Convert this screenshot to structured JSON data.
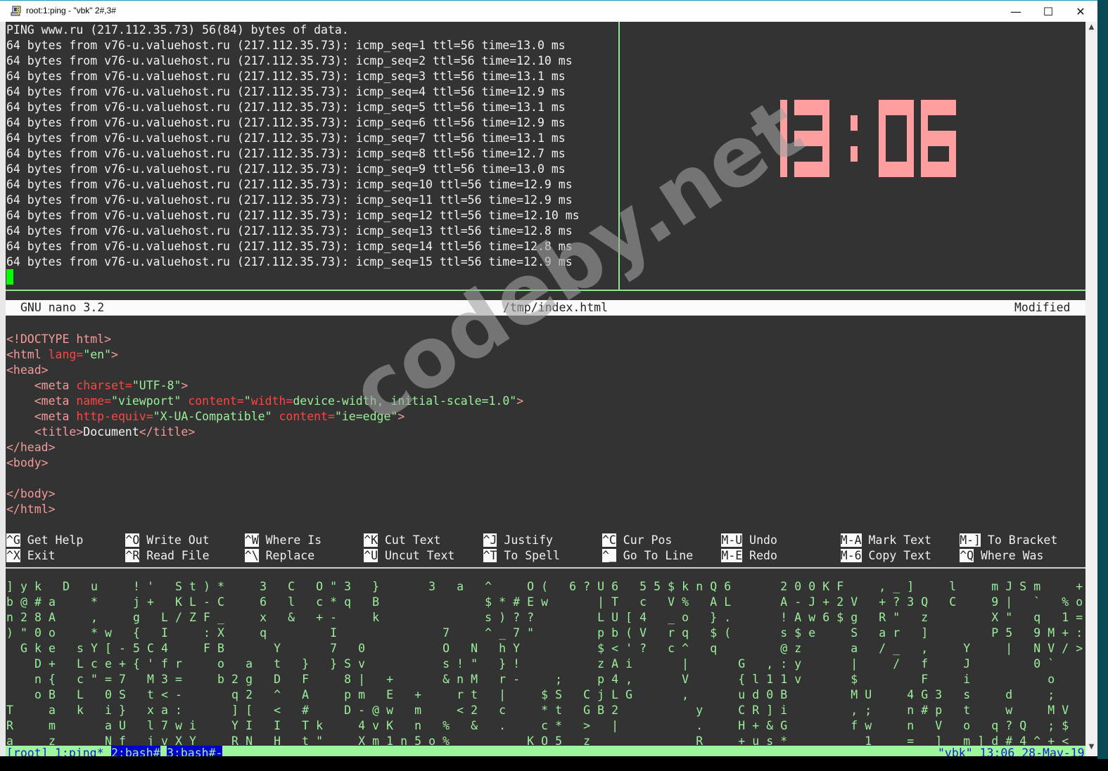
{
  "window": {
    "title": "root:1:ping - \"vbk\" 2#,3#",
    "minimize": "—",
    "maximize": "☐",
    "close": "✕"
  },
  "ping": {
    "header": "PING www.ru (217.112.35.73) 56(84) bytes of data.",
    "lines": [
      "64 bytes from v76-u.valuehost.ru (217.112.35.73): icmp_seq=1 ttl=56 time=13.0 ms",
      "64 bytes from v76-u.valuehost.ru (217.112.35.73): icmp_seq=2 ttl=56 time=12.10 ms",
      "64 bytes from v76-u.valuehost.ru (217.112.35.73): icmp_seq=3 ttl=56 time=13.1 ms",
      "64 bytes from v76-u.valuehost.ru (217.112.35.73): icmp_seq=4 ttl=56 time=12.9 ms",
      "64 bytes from v76-u.valuehost.ru (217.112.35.73): icmp_seq=5 ttl=56 time=13.1 ms",
      "64 bytes from v76-u.valuehost.ru (217.112.35.73): icmp_seq=6 ttl=56 time=12.9 ms",
      "64 bytes from v76-u.valuehost.ru (217.112.35.73): icmp_seq=7 ttl=56 time=13.1 ms",
      "64 bytes from v76-u.valuehost.ru (217.112.35.73): icmp_seq=8 ttl=56 time=12.7 ms",
      "64 bytes from v76-u.valuehost.ru (217.112.35.73): icmp_seq=9 ttl=56 time=13.0 ms",
      "64 bytes from v76-u.valuehost.ru (217.112.35.73): icmp_seq=10 ttl=56 time=12.9 ms",
      "64 bytes from v76-u.valuehost.ru (217.112.35.73): icmp_seq=11 ttl=56 time=12.9 ms",
      "64 bytes from v76-u.valuehost.ru (217.112.35.73): icmp_seq=12 ttl=56 time=12.10 ms",
      "64 bytes from v76-u.valuehost.ru (217.112.35.73): icmp_seq=13 ttl=56 time=12.8 ms",
      "64 bytes from v76-u.valuehost.ru (217.112.35.73): icmp_seq=14 ttl=56 time=12.8 ms",
      "64 bytes from v76-u.valuehost.ru (217.112.35.73): icmp_seq=15 ttl=56 time=12.9 ms"
    ]
  },
  "clock": {
    "time": "13:06",
    "color": "#ff9e9e"
  },
  "nano": {
    "version": "GNU nano 3.2",
    "filename": "/tmp/index.html",
    "state": "Modified",
    "code": [
      {
        "row": 20,
        "segs": [
          [
            "tag",
            "<!DOCTYPE html>"
          ]
        ]
      },
      {
        "row": 21,
        "segs": [
          [
            "tag",
            "<html "
          ],
          [
            "attr",
            "lang="
          ],
          [
            "str",
            "\"en\""
          ],
          [
            "tag",
            ">"
          ]
        ]
      },
      {
        "row": 22,
        "segs": [
          [
            "tag",
            "<head>"
          ]
        ]
      },
      {
        "row": 23,
        "segs": [
          [
            "text",
            "    "
          ],
          [
            "tag",
            "<meta "
          ],
          [
            "attr",
            "charset="
          ],
          [
            "str",
            "\"UTF-8\""
          ],
          [
            "tag",
            ">"
          ]
        ]
      },
      {
        "row": 24,
        "segs": [
          [
            "text",
            "    "
          ],
          [
            "tag",
            "<meta "
          ],
          [
            "attr",
            "name="
          ],
          [
            "str",
            "\"viewport\" "
          ],
          [
            "attr",
            "content="
          ],
          [
            "str",
            "\""
          ],
          [
            "attr",
            "width="
          ],
          [
            "str",
            "device-width, initial-scale=1.0\""
          ],
          [
            "tag",
            ">"
          ]
        ]
      },
      {
        "row": 25,
        "segs": [
          [
            "text",
            "    "
          ],
          [
            "tag",
            "<meta "
          ],
          [
            "attr",
            "http-equiv="
          ],
          [
            "str",
            "\"X-UA-Compatible\" "
          ],
          [
            "attr",
            "content="
          ],
          [
            "str",
            "\"ie=edge\""
          ],
          [
            "tag",
            ">"
          ]
        ]
      },
      {
        "row": 26,
        "segs": [
          [
            "text",
            "    "
          ],
          [
            "tag",
            "<title>"
          ],
          [
            "text",
            "Document"
          ],
          [
            "tag",
            "</title>"
          ]
        ]
      },
      {
        "row": 27,
        "segs": [
          [
            "tag",
            "</head>"
          ]
        ]
      },
      {
        "row": 28,
        "segs": [
          [
            "tag",
            "<body>"
          ]
        ]
      },
      {
        "row": 30,
        "segs": [
          [
            "tag",
            "</body>"
          ]
        ]
      },
      {
        "row": 31,
        "segs": [
          [
            "tag",
            "</html>"
          ]
        ]
      }
    ],
    "shortcuts": [
      [
        {
          "key": "^G",
          "label": "Get Help"
        },
        {
          "key": "^O",
          "label": "Write Out"
        },
        {
          "key": "^W",
          "label": "Where Is"
        },
        {
          "key": "^K",
          "label": "Cut Text"
        },
        {
          "key": "^J",
          "label": "Justify"
        },
        {
          "key": "^C",
          "label": "Cur Pos"
        },
        {
          "key": "M-U",
          "label": "Undo"
        },
        {
          "key": "M-A",
          "label": "Mark Text"
        },
        {
          "key": "M-]",
          "label": "To Bracket"
        }
      ],
      [
        {
          "key": "^X",
          "label": "Exit"
        },
        {
          "key": "^R",
          "label": "Read File"
        },
        {
          "key": "^\\",
          "label": "Replace"
        },
        {
          "key": "^U",
          "label": "Uncut Text"
        },
        {
          "key": "^T",
          "label": "To Spell"
        },
        {
          "key": "^_",
          "label": "Go To Line"
        },
        {
          "key": "M-E",
          "label": "Redo"
        },
        {
          "key": "M-6",
          "label": "Copy Text"
        },
        {
          "key": "^Q",
          "label": "Where Was"
        }
      ]
    ]
  },
  "matrix": {
    "rows": [
      "]yk D u  !' St)*  3 C O\"3 }   3 a ^  O( 6?U6 55$knQ6   200KF  ,_]  l  mJSm  +",
      "b@#a  *  j+ KL-C  6 l c*q B       $*#Ew   |T c V% AL   A-J+2V +?3Q C  9| ` %o",
      "n28A  ,  g L/ZF_  x & +-  k       s)??    LU[4 _o }.   !Aw6$g R\" z    X\" q 1=",
      ")\"0o  *w { I  :X  q    I       7  ^_7\"    pb(V rq $(   s$e  S ar ]    P5 9M+:",
      " Gke sY[-5C4  FB   Y   7 0     O N hY     $<'? c^ q    @z   a /_ ,  Y  | NV/>",
      "  D+ Lce+{'fr  o a t } }Sv     s!\" }!     zAi   |   G ,:y   |  / f  J    0`",
      "  n{ c\"=7 M3=  b2g D F  8| +   &nM r-  ;  p4,   V   {l11v   $    F  i     o",
      "  oB L 0S t<-   q2 ^ A  pm E +  rt |  $S CjLG   ,   ud0B    MU  4G3 s  d  ;",
      "T  a k i} xa:   ][ < #  D-@w m  <2 c  *t GB2     y  CR]i    ,;  n#p t  w  MV",
      "R  m   aU l7wi  YI I Tk  4vK n % & .  c* > |     .  H+&G    fw  n V o q?Q ;$",
      "a  z   Nf jvXY  RN H t\"  Xm1n5o%     KO5 z _     R  +us*     1  = ] m]d#4^+<"
    ]
  },
  "tmux": {
    "session": "[root]",
    "windows": [
      "1:ping*",
      "2:bash#",
      "3:bash#-"
    ],
    "right": "\"vbk\" 13:06 28-May-19"
  },
  "watermark": "codeby.net"
}
